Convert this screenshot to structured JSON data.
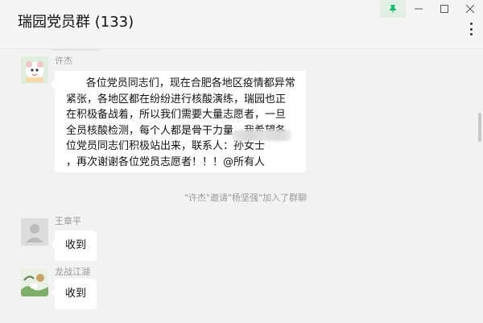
{
  "window": {
    "title": "瑞园党员群 (133)",
    "controls": {
      "pin": "pin-icon",
      "minimize": "minimize-icon",
      "maximize": "maximize-icon",
      "close": "close-icon",
      "more": "more-icon"
    },
    "pin_active_color": "#07c160"
  },
  "messages": [
    {
      "sender": "许杰",
      "text": "      各位党员同志们，现在合肥各地区疫情都异常紧张，各地区都在纷纷进行核酸演练，瑞园也正在积极备战着，所以我们需要大量志愿者，一旦全员核酸检测，每个人都是骨干力量，我希望各位党员同志们积极站出来，联系人：孙女士              ，再次谢谢各位党员志愿者！！！@所有人"
    },
    {
      "system": "\"许杰\"邀请\"杨坚强\"加入了群聊"
    },
    {
      "sender": "王章平",
      "text": "收到"
    },
    {
      "sender": "龙战江湖",
      "text": "收到"
    }
  ],
  "colors": {
    "background": "#f2f2f2",
    "bubble": "#ffffff",
    "meta_text": "#9a9a9a"
  }
}
